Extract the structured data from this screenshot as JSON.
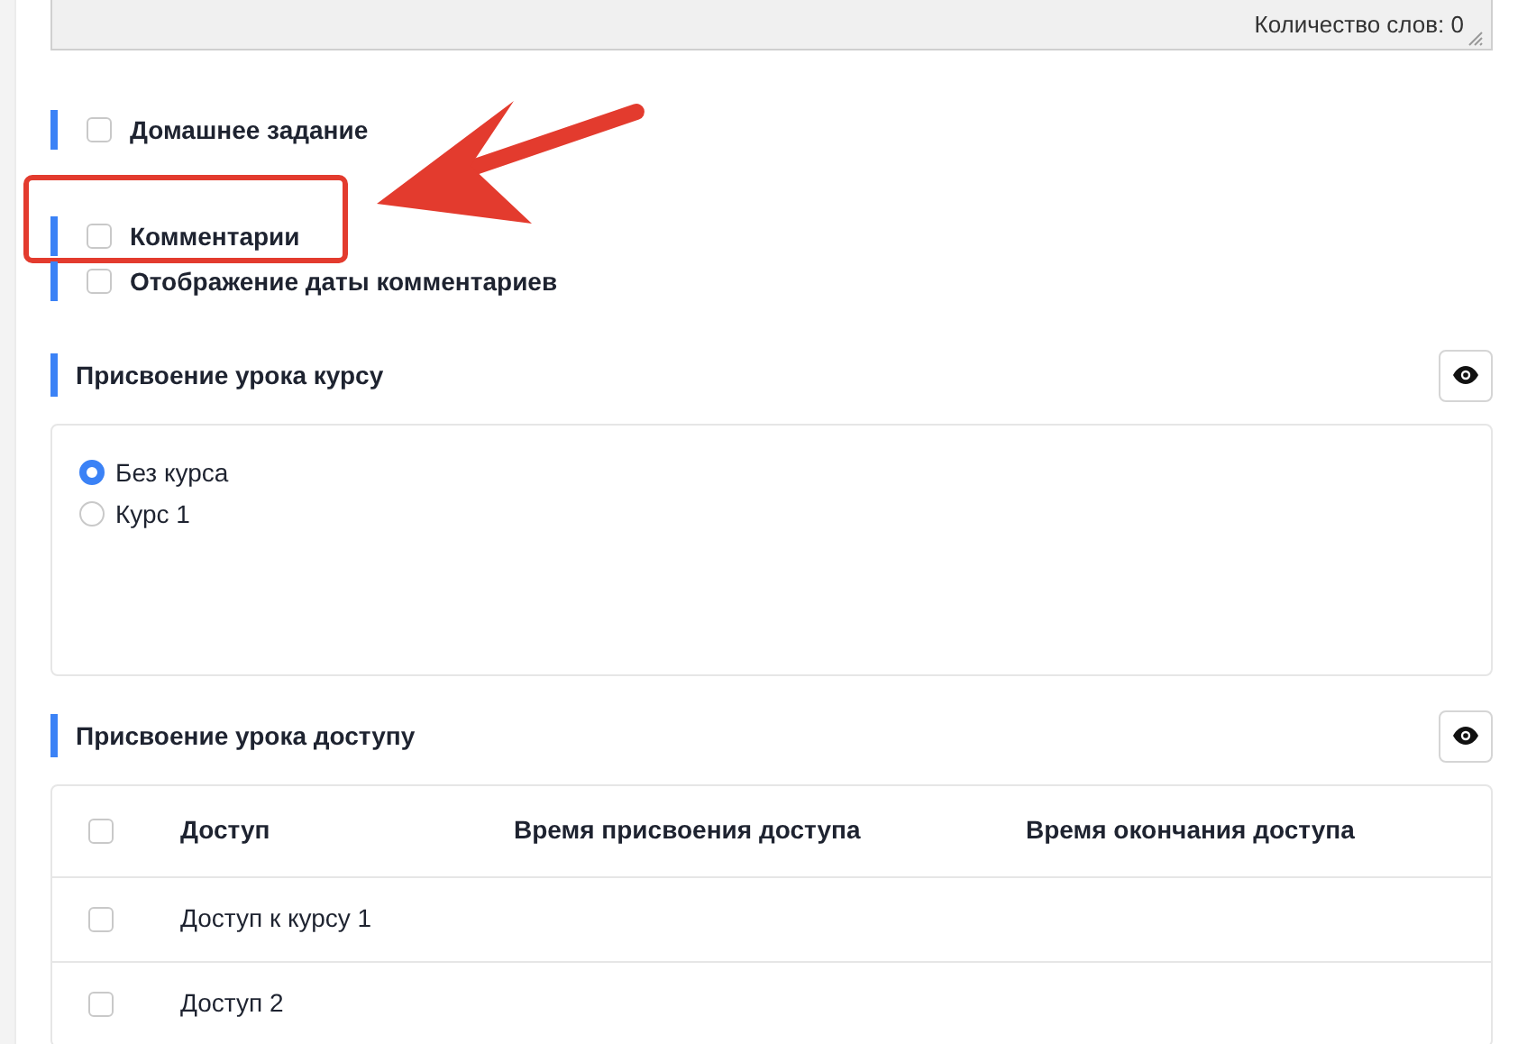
{
  "editor": {
    "word_count": "Количество слов: 0"
  },
  "options": [
    {
      "label": "Домашнее задание",
      "checked": false,
      "highlighted": false
    },
    {
      "label": "Комментарии",
      "checked": false,
      "highlighted": true
    },
    {
      "label": "Отображение даты комментариев",
      "checked": false,
      "highlighted": false
    }
  ],
  "course_section": {
    "title": "Присвоение урока курсу",
    "choices": [
      {
        "label": "Без курса",
        "selected": true
      },
      {
        "label": "Курс 1",
        "selected": false
      }
    ]
  },
  "access_section": {
    "title": "Присвоение урока доступу",
    "select_all_checked": false,
    "columns": [
      "Доступ",
      "Время присвоения доступа",
      "Время окончания доступа"
    ],
    "rows": [
      {
        "cells": [
          "Доступ к курсу 1"
        ],
        "checked": false
      },
      {
        "cells": [
          "Доступ 2"
        ],
        "checked": false
      }
    ]
  }
}
